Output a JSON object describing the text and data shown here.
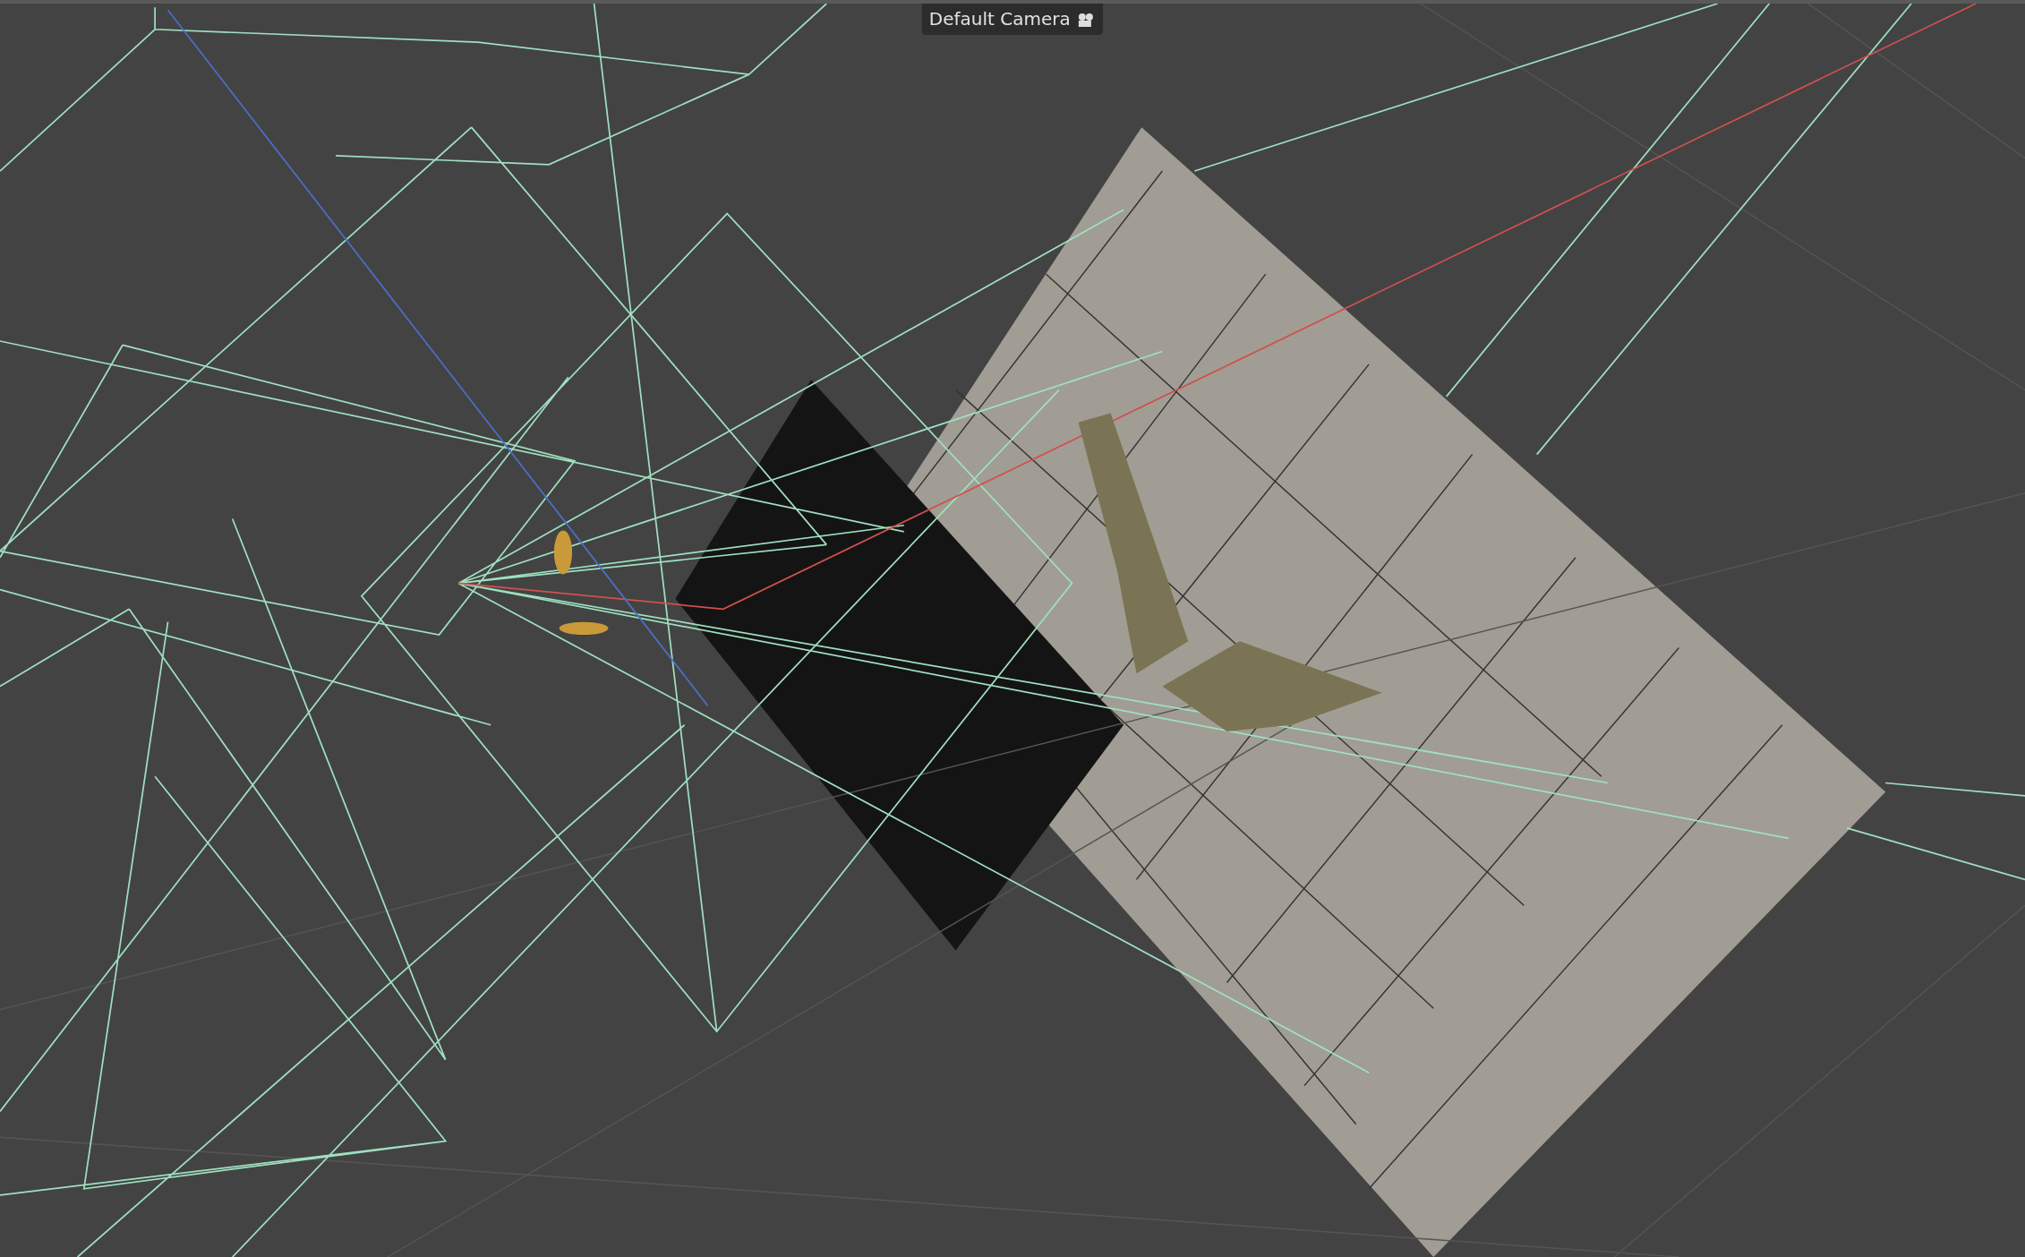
{
  "viewport": {
    "camera_label": "Default Camera"
  }
}
